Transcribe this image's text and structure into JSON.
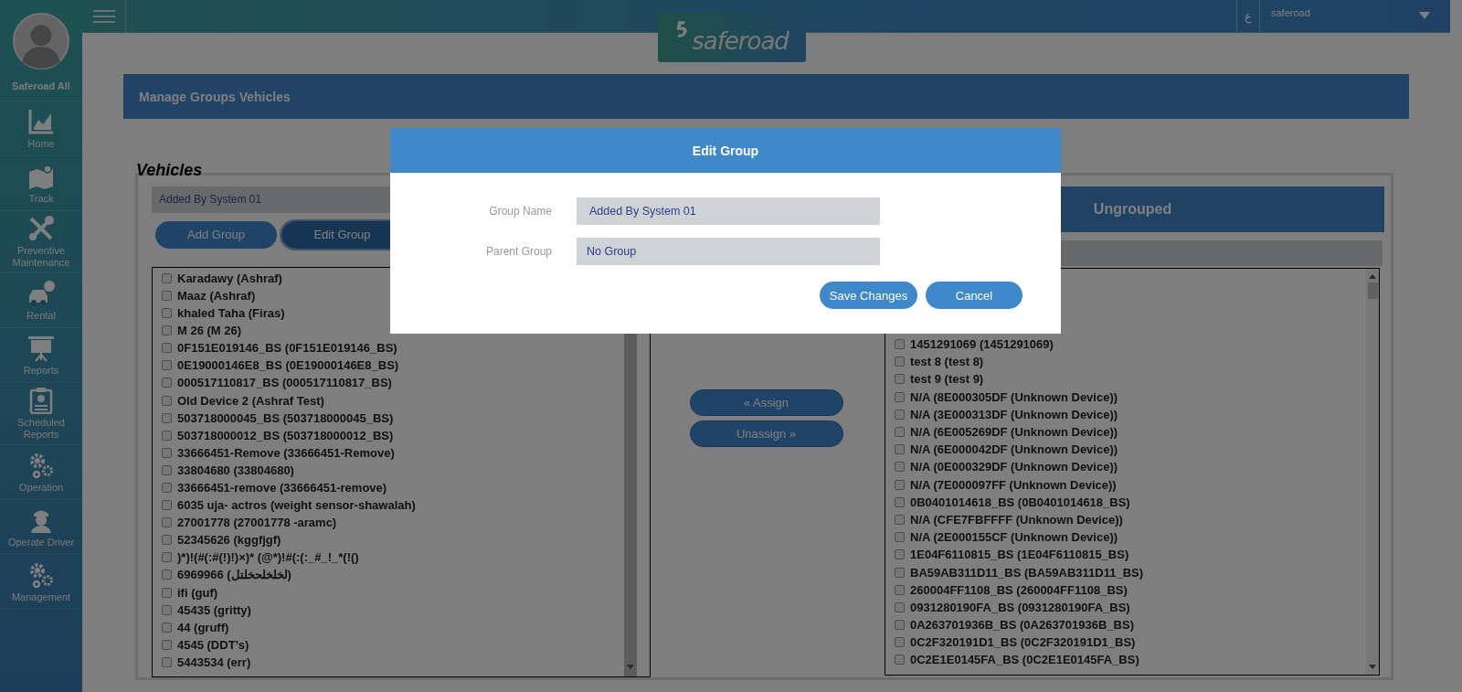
{
  "sidebar": {
    "user_name": "Saferoad All",
    "items": [
      {
        "label": "Home"
      },
      {
        "label": "Track"
      },
      {
        "label": "Preventive Maintenance"
      },
      {
        "label": "Rental"
      },
      {
        "label": "Reports"
      },
      {
        "label": "Scheduled Reports"
      },
      {
        "label": "Operation"
      },
      {
        "label": "Operate Driver"
      },
      {
        "label": "Management"
      }
    ]
  },
  "top_bar": {
    "language_toggle": "ع",
    "user": "saferoad"
  },
  "logo": {
    "text": "saferoad"
  },
  "page": {
    "title": "Manage Groups Vehicles",
    "section_title": "Vehicles",
    "group_select": "Added By System 01",
    "group_buttons": [
      {
        "label": "Add Group",
        "selected": false
      },
      {
        "label": "Edit Group",
        "selected": true
      }
    ],
    "left_list": [
      {
        "label": "Karadawy (Ashraf)",
        "checked": false
      },
      {
        "label": "Maaz (Ashraf)",
        "checked": false
      },
      {
        "label": "khaled Taha (Firas)",
        "checked": false
      },
      {
        "label": "M 26 (M 26)",
        "checked": false
      },
      {
        "label": "0F151E019146_BS (0F151E019146_BS)",
        "checked": false
      },
      {
        "label": "0E19000146E8_BS (0E19000146E8_BS)",
        "checked": false
      },
      {
        "label": "000517110817_BS (000517110817_BS)",
        "checked": false
      },
      {
        "label": "Old Device 2 (Ashraf Test)",
        "checked": false
      },
      {
        "label": "503718000045_BS (503718000045_BS)",
        "checked": false
      },
      {
        "label": "503718000012_BS (503718000012_BS)",
        "checked": false
      },
      {
        "label": "33666451-Remove (33666451-Remove)",
        "checked": false
      },
      {
        "label": "33804680 (33804680)",
        "checked": false
      },
      {
        "label": "33666451-remove (33666451-remove)",
        "checked": false
      },
      {
        "label": "6035 uja- actros (weight sensor-shawalah)",
        "checked": false
      },
      {
        "label": "27001778 (27001778 -aramc)",
        "checked": false
      },
      {
        "label": "52345626 (kggfjgf)",
        "checked": false
      },
      {
        "label": ")*)!(#(:#(!)!)×)* (@*)!#(:(:_#_!_*(!()",
        "checked": false
      },
      {
        "label": "6969966 (لخلخلحخلتل)",
        "checked": false
      },
      {
        "label": "ifi (guf)",
        "checked": false
      },
      {
        "label": "45435 (gritty)",
        "checked": false
      },
      {
        "label": "44 (gruff)",
        "checked": false
      },
      {
        "label": "4545 (DDT’s)",
        "checked": false
      },
      {
        "label": "5443534 (err)",
        "checked": false
      }
    ],
    "assign_buttons": [
      "« Assign",
      "Unassign »"
    ],
    "right_panel": {
      "title": "Ungrouped",
      "items": [
        {
          "label": "1451291069 (1451291069)",
          "checked": false
        },
        {
          "label": "test 8 (test 8)",
          "checked": false
        },
        {
          "label": "test 9 (test 9)",
          "checked": false
        },
        {
          "label": "N/A (8E000305DF (Unknown Device))",
          "checked": false
        },
        {
          "label": "N/A (3E000313DF (Unknown Device))",
          "checked": false
        },
        {
          "label": "N/A (6E005269DF (Unknown Device))",
          "checked": false
        },
        {
          "label": "N/A (6E000042DF (Unknown Device))",
          "checked": false
        },
        {
          "label": "N/A (0E000329DF (Unknown Device))",
          "checked": false
        },
        {
          "label": "N/A (7E000097FF (Unknown Device))",
          "checked": false
        },
        {
          "label": "0B0401014618_BS (0B0401014618_BS)",
          "checked": false
        },
        {
          "label": "N/A (CFE7FBFFFF (Unknown Device))",
          "checked": false
        },
        {
          "label": "N/A (2E000155CF (Unknown Device))",
          "checked": false
        },
        {
          "label": "1E04F6110815_BS (1E04F6110815_BS)",
          "checked": false
        },
        {
          "label": "BA59AB311D11_BS (BA59AB311D11_BS)",
          "checked": false
        },
        {
          "label": "260004FF1108_BS (260004FF1108_BS)",
          "checked": false
        },
        {
          "label": "0931280190FA_BS (0931280190FA_BS)",
          "checked": false
        },
        {
          "label": "0A263701936B_BS (0A263701936B_BS)",
          "checked": false
        },
        {
          "label": "0C2F320191D1_BS (0C2F320191D1_BS)",
          "checked": false
        },
        {
          "label": "0C2E1E0145FA_BS (0C2E1E0145FA_BS)",
          "checked": false
        }
      ]
    }
  },
  "modal": {
    "title": "Edit Group",
    "fields": [
      {
        "label": "Group Name",
        "value": "Added By System 01"
      },
      {
        "label": "Parent Group",
        "value": "No Group"
      }
    ],
    "buttons": [
      "Save Changes",
      "Cancel"
    ]
  }
}
